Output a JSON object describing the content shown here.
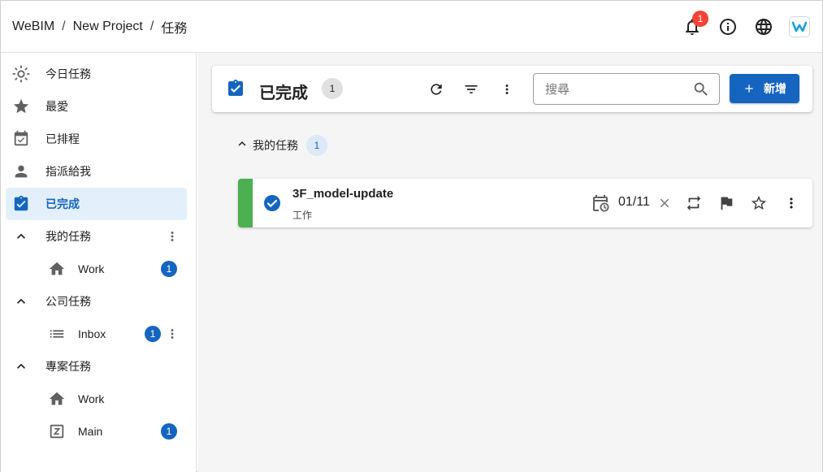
{
  "breadcrumb": {
    "app": "WeBIM",
    "project": "New Project",
    "page": "任務",
    "separator": "/"
  },
  "notifications": {
    "count": "1"
  },
  "sidebar": {
    "items": [
      {
        "label": "今日任務"
      },
      {
        "label": "最愛"
      },
      {
        "label": "已排程"
      },
      {
        "label": "指派給我"
      },
      {
        "label": "已完成"
      }
    ],
    "groups": [
      {
        "label": "我的任務",
        "children": [
          {
            "label": "Work",
            "count": "1"
          }
        ]
      },
      {
        "label": "公司任務",
        "children": [
          {
            "label": "Inbox",
            "count": "1"
          }
        ]
      },
      {
        "label": "專案任務",
        "children": [
          {
            "label": "Work"
          },
          {
            "label": "Main",
            "count": "1"
          }
        ]
      }
    ]
  },
  "header": {
    "title": "已完成",
    "count": "1",
    "search_placeholder": "搜尋",
    "add_label": "新增"
  },
  "task_group": {
    "label": "我的任務",
    "count": "1"
  },
  "task": {
    "title": "3F_model-update",
    "list": "工作",
    "due": "01/11"
  },
  "colors": {
    "accent": "#1565c0",
    "done_stripe": "#4caf50",
    "badge_red": "#f44336"
  }
}
